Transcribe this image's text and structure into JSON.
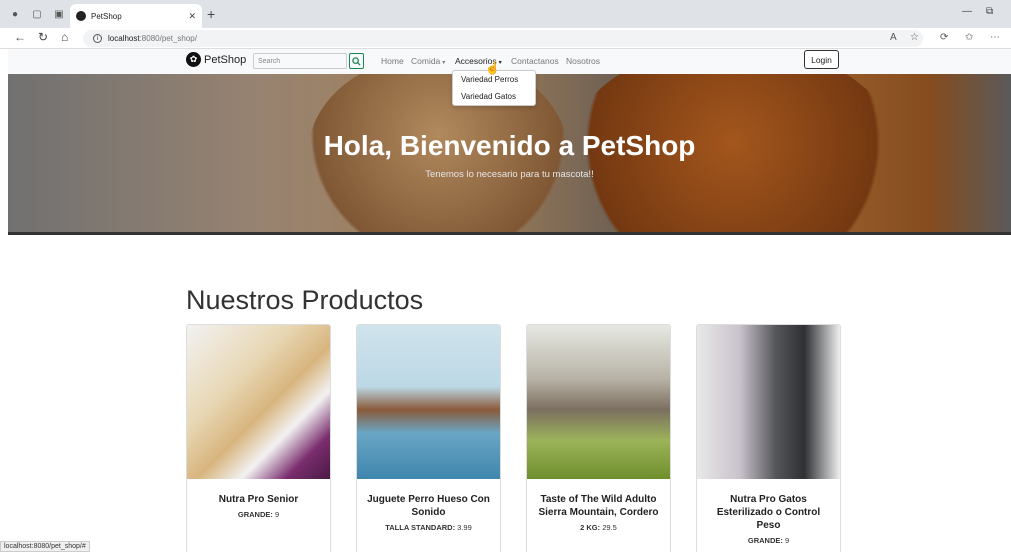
{
  "browser": {
    "tab_title": "PetShop",
    "url_host": "localhost",
    "url_path": ":8080/pet_shop/",
    "status_url": "localhost:8080/pet_shop/#"
  },
  "navbar": {
    "brand": "PetShop",
    "search_placeholder": "Search",
    "links": [
      "Home",
      "Comida",
      "Accesorios",
      "Contactanos",
      "Nosotros"
    ],
    "login": "Login"
  },
  "dropdown": {
    "items": [
      "Variedad Perros",
      "Variedad Gatos"
    ]
  },
  "hero": {
    "title": "Hola, Bienvenido a PetShop",
    "subtitle": "Tenemos lo necesario para tu mascota!!"
  },
  "products": {
    "title": "Nuestros Productos",
    "items": [
      {
        "name": "Nutra Pro Senior",
        "size_label": "GRANDE:",
        "size_value": "9"
      },
      {
        "name": "Juguete Perro Hueso Con Sonido",
        "size_label": "TALLA STANDARD:",
        "size_value": "3.99"
      },
      {
        "name": "Taste of The Wild Adulto Sierra Mountain, Cordero",
        "size_label": "2 KG:",
        "size_value": "29.5"
      },
      {
        "name": "Nutra Pro Gatos Esterilizado o Control Peso",
        "size_label": "GRANDE:",
        "size_value": "9"
      }
    ]
  },
  "colors": {
    "search_btn": "#198754",
    "navbar_bg": "#f8f9fa"
  }
}
